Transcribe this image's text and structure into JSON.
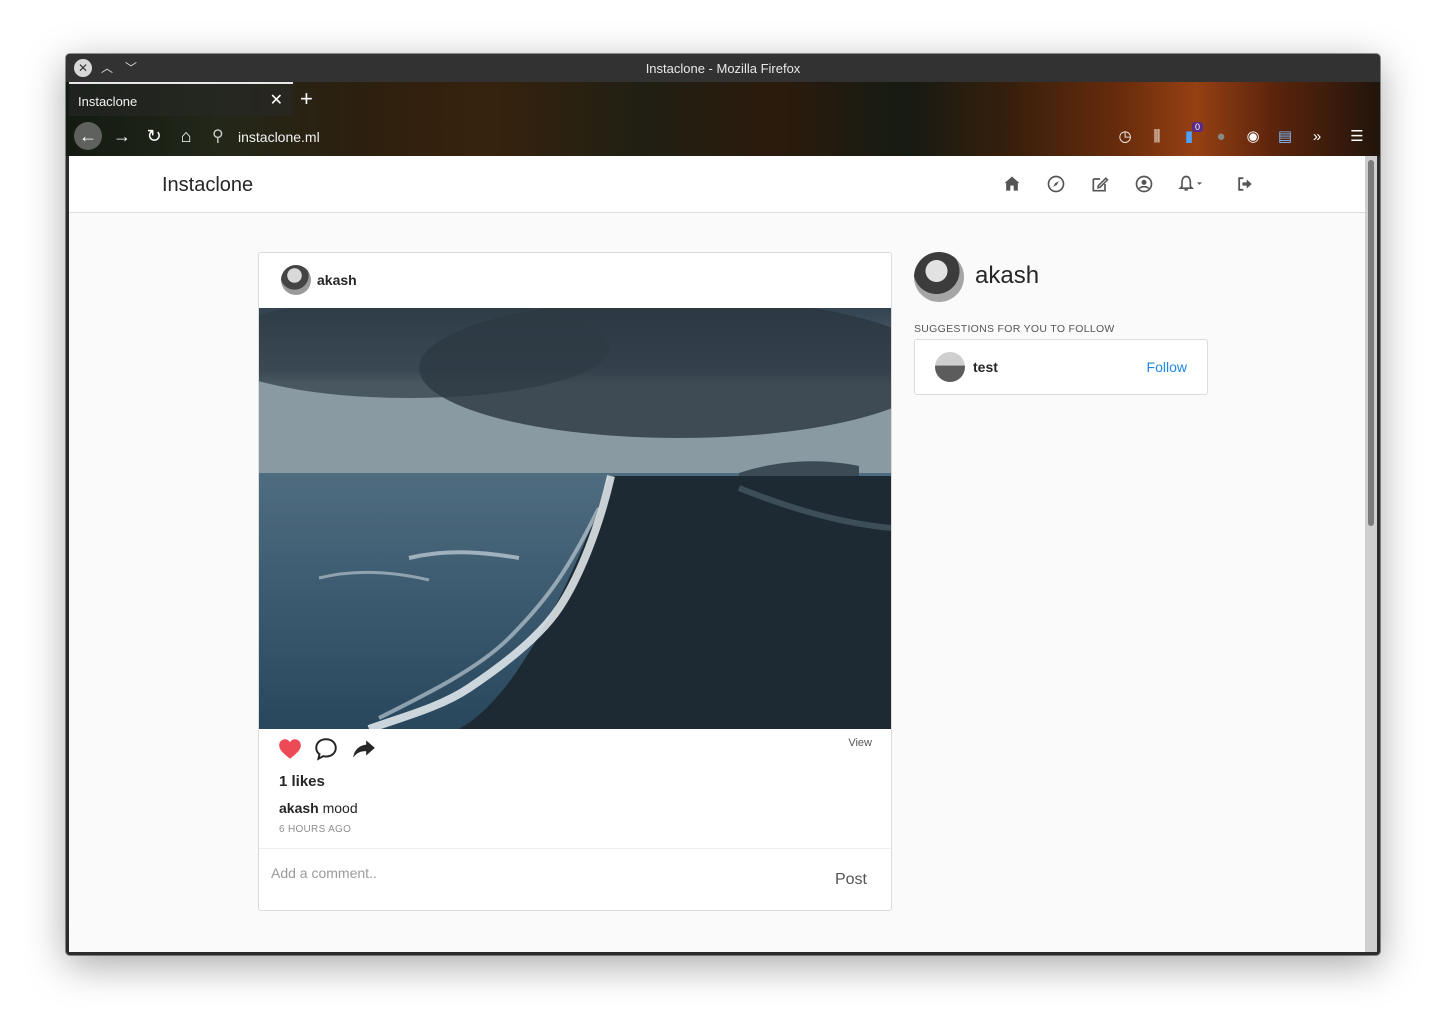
{
  "window": {
    "title": "Instaclone - Mozilla Firefox"
  },
  "browser": {
    "tab_title": "Instaclone",
    "url": "instaclone.ml",
    "badge_count": "0",
    "icons": [
      "back-arrow-icon",
      "forward-arrow-icon",
      "reload-icon",
      "home-icon",
      "search-icon",
      "history-icon",
      "library-icon",
      "extension-icon",
      "account-icon",
      "containers-icon",
      "overflow-icon",
      "menu-icon"
    ]
  },
  "site": {
    "brand": "Instaclone",
    "nav_icons": [
      "home-icon",
      "compass-icon",
      "edit-icon",
      "profile-icon",
      "bell-icon",
      "logout-icon"
    ]
  },
  "post": {
    "username": "akash",
    "likes": "1 likes",
    "caption_user": "akash",
    "caption_text": " mood",
    "time": "6 HOURS AGO",
    "view_label": "View",
    "comment_placeholder": "Add a comment..",
    "post_label": "Post",
    "liked": true,
    "heart_color": "#ed4956"
  },
  "sidebar": {
    "username": "akash",
    "suggestions_title": "SUGGESTIONS FOR YOU TO FOLLOW",
    "suggestions": [
      {
        "username": "test",
        "action": "Follow"
      }
    ],
    "link_color": "#1e88e5"
  }
}
